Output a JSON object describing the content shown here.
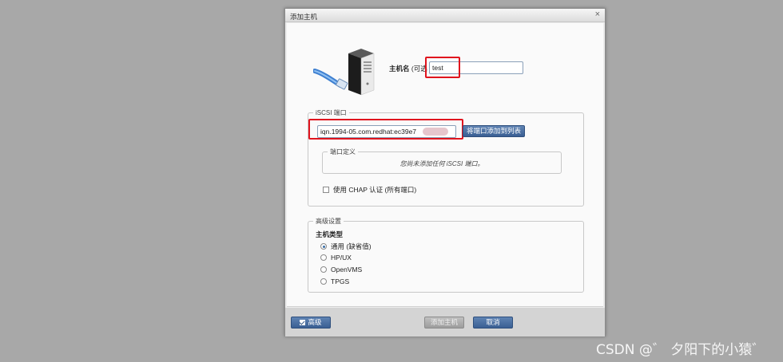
{
  "dialog": {
    "title": "添加主机",
    "close_label": "×"
  },
  "host": {
    "name_label": "主机名",
    "optional_label": "(可选",
    "name_value": "test"
  },
  "iscsi": {
    "legend": "iSCSI 端口",
    "iqn_value": "iqn.1994-05.com.redhat:ec39e7",
    "add_button": "将端口添加到列表",
    "port_def_legend": "端口定义",
    "empty_message": "您尚未添加任何 iSCSI 端口。",
    "chap_label": "使用 CHAP 认证 (所有端口)"
  },
  "advanced": {
    "legend": "高级设置",
    "host_type_label": "主机类型",
    "options": [
      "通用 (缺省值)",
      "HP/UX",
      "OpenVMS",
      "TPGS"
    ],
    "selected_index": 0
  },
  "footer": {
    "advanced_button": "高级",
    "add_host_button": "添加主机",
    "cancel_button": "取消"
  },
  "watermark": "CSDN @゛ 夕阳下的小猿゛",
  "colors": {
    "highlight_red": "#e0141e",
    "button_blue": "#3a5f93",
    "backdrop": "#a8a8a8"
  },
  "icons": {
    "host": "server-with-network-cable-icon"
  }
}
